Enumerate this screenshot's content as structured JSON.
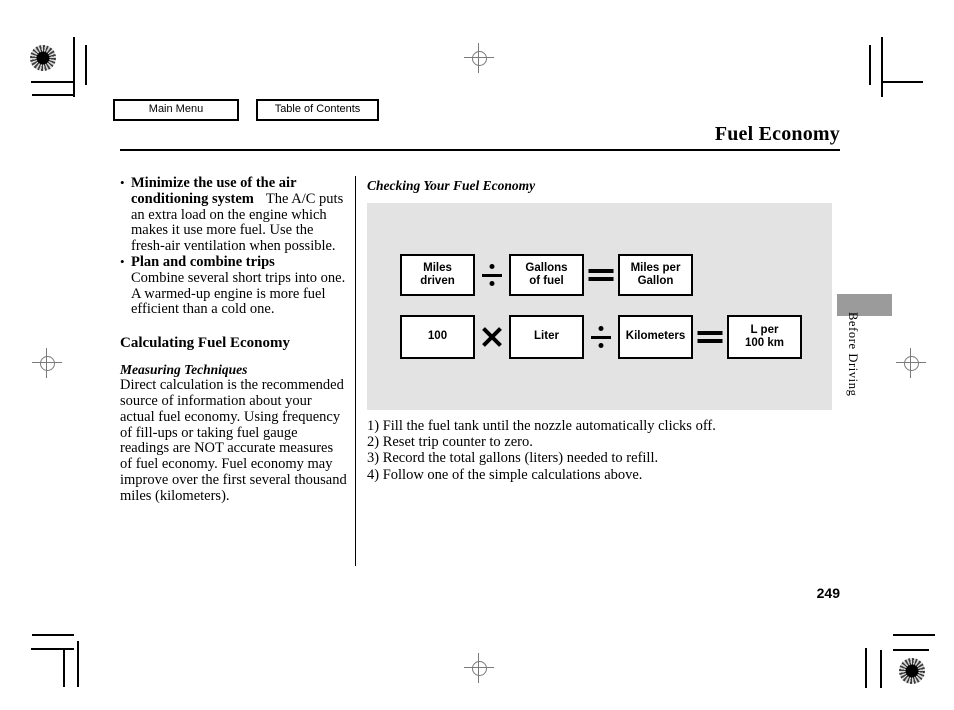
{
  "nav": {
    "main_menu": "Main Menu",
    "table_of_contents": "Table of Contents"
  },
  "header": {
    "title": "Fuel Economy"
  },
  "left_column": {
    "bullets": [
      {
        "lead": "Minimize the use of the air conditioning system",
        "text": "The A/C puts an extra load on the engine which makes it use more fuel. Use the fresh-air ventilation when possible."
      },
      {
        "lead": "Plan and combine trips",
        "text": "Combine several short trips into one. A warmed-up engine is more fuel efficient than a cold one."
      }
    ],
    "section_heading": "Calculating Fuel Economy",
    "sub_heading": "Measuring Techniques",
    "paragraph": "Direct calculation is the recommended source of information about your actual fuel economy. Using frequency of fill-ups or taking fuel gauge readings are NOT accurate measures of fuel economy. Fuel economy may improve over the first several thousand miles (kilometers)."
  },
  "right_column": {
    "figure_caption": "Checking Your Fuel Economy",
    "equations": [
      {
        "terms": [
          "Miles\ndriven",
          "Gallons\nof fuel",
          "Miles per\nGallon"
        ],
        "operators": [
          "divide",
          "equals"
        ]
      },
      {
        "terms": [
          "100",
          "Liter",
          "Kilometers",
          "L per\n100 km"
        ],
        "operators": [
          "multiply",
          "divide",
          "equals"
        ]
      }
    ],
    "steps": [
      "1) Fill the fuel tank until the nozzle automatically clicks off.",
      "2) Reset trip counter to zero.",
      "3) Record the total gallons (liters) needed to refill.",
      "4) Follow one of the simple calculations above."
    ]
  },
  "side_tab": {
    "label": "Before Driving"
  },
  "footer": {
    "page_number": "249"
  },
  "colors": {
    "figure_background": "#e3e3e3",
    "side_tab": "#9b9b9b",
    "text": "#000000"
  }
}
